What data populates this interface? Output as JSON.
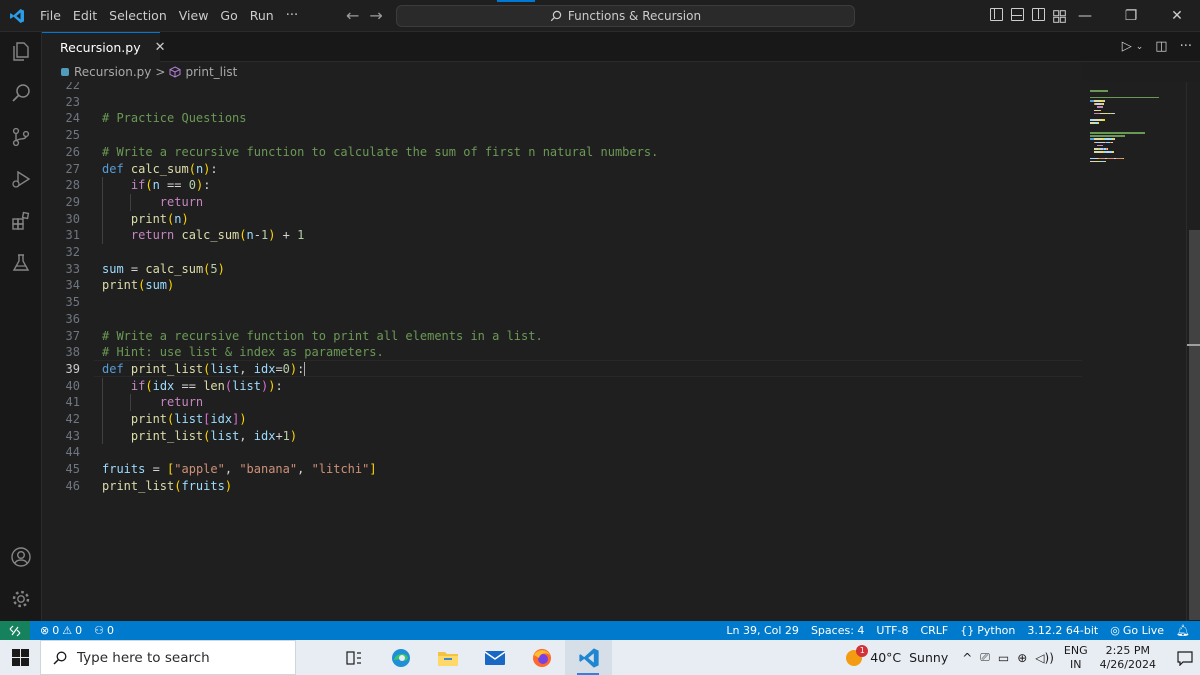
{
  "menu": [
    "File",
    "Edit",
    "Selection",
    "View",
    "Go",
    "Run"
  ],
  "menu_more": "···",
  "command_center": "Functions & Recursion",
  "tab": {
    "label": "Recursion.py",
    "close": "✕"
  },
  "breadcrumb": {
    "file": "Recursion.py",
    "separator": ">",
    "symbol": "print_list"
  },
  "editor": {
    "active_line": 39,
    "lines": [
      {
        "n": "22",
        "segments": []
      },
      {
        "n": "23",
        "segments": []
      },
      {
        "n": "24",
        "segments": [
          {
            "t": "# Practice Questions",
            "c": "c-com"
          }
        ]
      },
      {
        "n": "25",
        "segments": []
      },
      {
        "n": "26",
        "segments": [
          {
            "t": "# Write a recursive function to calculate the sum of first n natural numbers.",
            "c": "c-com"
          }
        ]
      },
      {
        "n": "27",
        "segments": [
          {
            "t": "def ",
            "c": "c-kw"
          },
          {
            "t": "calc_sum",
            "c": "c-fn"
          },
          {
            "t": "(",
            "c": "c-br1"
          },
          {
            "t": "n",
            "c": "c-var"
          },
          {
            "t": ")",
            "c": "c-br1"
          },
          {
            "t": ":",
            "c": "c-pun"
          }
        ]
      },
      {
        "n": "28",
        "segments": [
          {
            "t": "    ",
            "c": "c-pun"
          },
          {
            "t": "if",
            "c": "c-ctl"
          },
          {
            "t": "(",
            "c": "c-br1"
          },
          {
            "t": "n",
            "c": "c-var"
          },
          {
            "t": " == ",
            "c": "c-pun"
          },
          {
            "t": "0",
            "c": "c-num"
          },
          {
            "t": ")",
            "c": "c-br1"
          },
          {
            "t": ":",
            "c": "c-pun"
          }
        ]
      },
      {
        "n": "29",
        "segments": [
          {
            "t": "        ",
            "c": "c-pun"
          },
          {
            "t": "return",
            "c": "c-ctl"
          }
        ]
      },
      {
        "n": "30",
        "segments": [
          {
            "t": "    ",
            "c": "c-pun"
          },
          {
            "t": "print",
            "c": "c-fn"
          },
          {
            "t": "(",
            "c": "c-br1"
          },
          {
            "t": "n",
            "c": "c-var"
          },
          {
            "t": ")",
            "c": "c-br1"
          }
        ]
      },
      {
        "n": "31",
        "segments": [
          {
            "t": "    ",
            "c": "c-pun"
          },
          {
            "t": "return ",
            "c": "c-ctl"
          },
          {
            "t": "calc_sum",
            "c": "c-fn"
          },
          {
            "t": "(",
            "c": "c-br1"
          },
          {
            "t": "n",
            "c": "c-var"
          },
          {
            "t": "-",
            "c": "c-pun"
          },
          {
            "t": "1",
            "c": "c-num"
          },
          {
            "t": ")",
            "c": "c-br1"
          },
          {
            "t": " + ",
            "c": "c-pun"
          },
          {
            "t": "1",
            "c": "c-num"
          }
        ]
      },
      {
        "n": "32",
        "segments": []
      },
      {
        "n": "33",
        "segments": [
          {
            "t": "sum",
            "c": "c-var"
          },
          {
            "t": " = ",
            "c": "c-pun"
          },
          {
            "t": "calc_sum",
            "c": "c-fn"
          },
          {
            "t": "(",
            "c": "c-br1"
          },
          {
            "t": "5",
            "c": "c-num"
          },
          {
            "t": ")",
            "c": "c-br1"
          }
        ]
      },
      {
        "n": "34",
        "segments": [
          {
            "t": "print",
            "c": "c-fn"
          },
          {
            "t": "(",
            "c": "c-br1"
          },
          {
            "t": "sum",
            "c": "c-var"
          },
          {
            "t": ")",
            "c": "c-br1"
          }
        ]
      },
      {
        "n": "35",
        "segments": []
      },
      {
        "n": "36",
        "segments": []
      },
      {
        "n": "37",
        "segments": [
          {
            "t": "# Write a recursive function to print all elements in a list.",
            "c": "c-com"
          }
        ]
      },
      {
        "n": "38",
        "segments": [
          {
            "t": "# Hint: use list & index as parameters.",
            "c": "c-com"
          }
        ]
      },
      {
        "n": "39",
        "segments": [
          {
            "t": "def ",
            "c": "c-kw"
          },
          {
            "t": "print_list",
            "c": "c-fn"
          },
          {
            "t": "(",
            "c": "c-br1"
          },
          {
            "t": "list",
            "c": "c-var"
          },
          {
            "t": ", ",
            "c": "c-pun"
          },
          {
            "t": "idx",
            "c": "c-var"
          },
          {
            "t": "=",
            "c": "c-pun"
          },
          {
            "t": "0",
            "c": "c-num"
          },
          {
            "t": ")",
            "c": "c-br1"
          },
          {
            "t": ":",
            "c": "c-pun"
          }
        ]
      },
      {
        "n": "40",
        "segments": [
          {
            "t": "    ",
            "c": "c-pun"
          },
          {
            "t": "if",
            "c": "c-ctl"
          },
          {
            "t": "(",
            "c": "c-br1"
          },
          {
            "t": "idx",
            "c": "c-var"
          },
          {
            "t": " == ",
            "c": "c-pun"
          },
          {
            "t": "len",
            "c": "c-fn"
          },
          {
            "t": "(",
            "c": "c-br2"
          },
          {
            "t": "list",
            "c": "c-var"
          },
          {
            "t": ")",
            "c": "c-br2"
          },
          {
            "t": ")",
            "c": "c-br1"
          },
          {
            "t": ":",
            "c": "c-pun"
          }
        ]
      },
      {
        "n": "41",
        "segments": [
          {
            "t": "        ",
            "c": "c-pun"
          },
          {
            "t": "return",
            "c": "c-ctl"
          }
        ]
      },
      {
        "n": "42",
        "segments": [
          {
            "t": "    ",
            "c": "c-pun"
          },
          {
            "t": "print",
            "c": "c-fn"
          },
          {
            "t": "(",
            "c": "c-br1"
          },
          {
            "t": "list",
            "c": "c-var"
          },
          {
            "t": "[",
            "c": "c-br2"
          },
          {
            "t": "idx",
            "c": "c-var"
          },
          {
            "t": "]",
            "c": "c-br2"
          },
          {
            "t": ")",
            "c": "c-br1"
          }
        ]
      },
      {
        "n": "43",
        "segments": [
          {
            "t": "    ",
            "c": "c-pun"
          },
          {
            "t": "print_list",
            "c": "c-fn"
          },
          {
            "t": "(",
            "c": "c-br1"
          },
          {
            "t": "list",
            "c": "c-var"
          },
          {
            "t": ", ",
            "c": "c-pun"
          },
          {
            "t": "idx",
            "c": "c-var"
          },
          {
            "t": "+",
            "c": "c-pun"
          },
          {
            "t": "1",
            "c": "c-num"
          },
          {
            "t": ")",
            "c": "c-br1"
          }
        ]
      },
      {
        "n": "44",
        "segments": []
      },
      {
        "n": "45",
        "segments": [
          {
            "t": "fruits",
            "c": "c-var"
          },
          {
            "t": " = ",
            "c": "c-pun"
          },
          {
            "t": "[",
            "c": "c-br1"
          },
          {
            "t": "\"apple\"",
            "c": "c-str"
          },
          {
            "t": ", ",
            "c": "c-pun"
          },
          {
            "t": "\"banana\"",
            "c": "c-str"
          },
          {
            "t": ", ",
            "c": "c-pun"
          },
          {
            "t": "\"litchi\"",
            "c": "c-str"
          },
          {
            "t": "]",
            "c": "c-br1"
          }
        ]
      },
      {
        "n": "46",
        "segments": [
          {
            "t": "print_list",
            "c": "c-fn"
          },
          {
            "t": "(",
            "c": "c-br1"
          },
          {
            "t": "fruits",
            "c": "c-var"
          },
          {
            "t": ")",
            "c": "c-br1"
          }
        ]
      }
    ]
  },
  "status": {
    "errors": "0",
    "warnings": "0",
    "ports": "0",
    "position": "Ln 39, Col 29",
    "spaces": "Spaces: 4",
    "encoding": "UTF-8",
    "eol": "CRLF",
    "language": "Python",
    "interpreter": "3.12.2 64-bit",
    "golive": "Go Live"
  },
  "taskbar": {
    "search_placeholder": "Type here to search",
    "weather": "40°C  Sunny",
    "weather_badge": "1",
    "lang_top": "ENG",
    "lang_bottom": "IN",
    "time": "2:25 PM",
    "date": "4/26/2024"
  },
  "colors": {
    "accent": "#007acc",
    "editor_bg": "#1f1f1f",
    "comment": "#6a9955",
    "keyword": "#569cd6"
  }
}
